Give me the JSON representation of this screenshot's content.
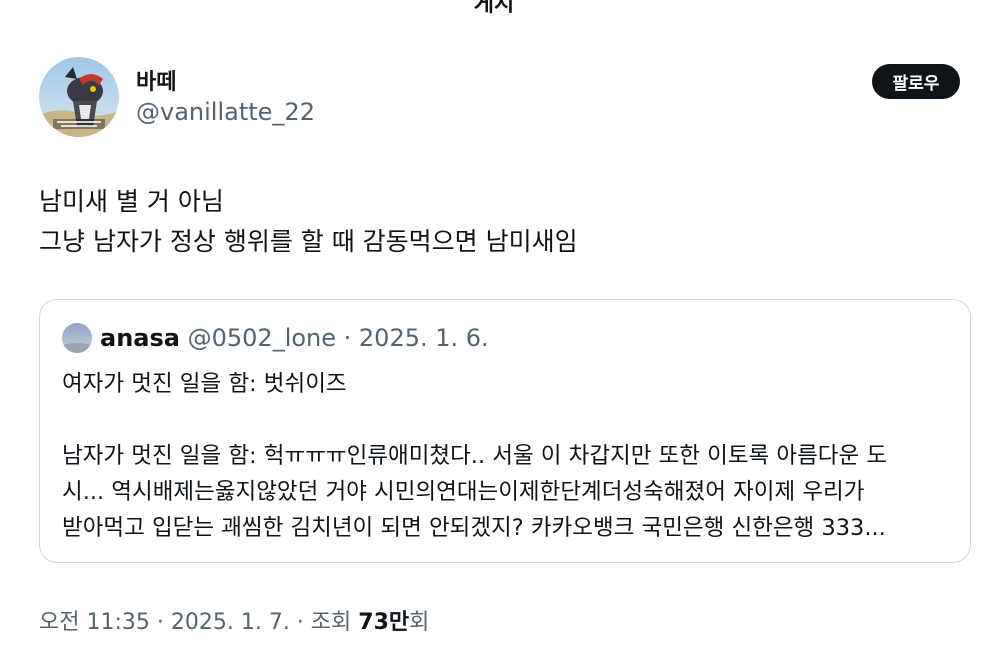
{
  "header": {
    "title": "게시"
  },
  "author": {
    "display_name": "바떼",
    "handle": "@vanillatte_22",
    "follow_label": "팔로우"
  },
  "tweet": {
    "lines": [
      "남미새 별 거 아님",
      "그냥 남자가 정상 행위를 할 때 감동먹으면 남미새임"
    ]
  },
  "quote": {
    "name": "anasa",
    "handle": "@0502_lone",
    "separator": " · ",
    "date": "2025. 1. 6.",
    "lines": [
      "여자가 멋진 일을 함: 벗쉬이즈",
      "",
      "남자가 멋진 일을 함: 헉ㅠㅠㅠ인류애미쳤다.. 서울 이 차갑지만 또한 이토록 아름다운 도",
      "시... 역시배제는옳지않았던 거야 시민의연대는이제한단계더성숙해졌어 자이제 우리가",
      "받아먹고 입닫는 괘씸한 김치년이 되면 안되겠지? 카카오뱅크 국민은행 신한은행 333..."
    ]
  },
  "meta": {
    "time": "오전 11:35",
    "sep": " · ",
    "date": "2025. 1. 7.",
    "views_prefix": "조회 ",
    "views_count": "73만",
    "views_suffix": "회"
  }
}
